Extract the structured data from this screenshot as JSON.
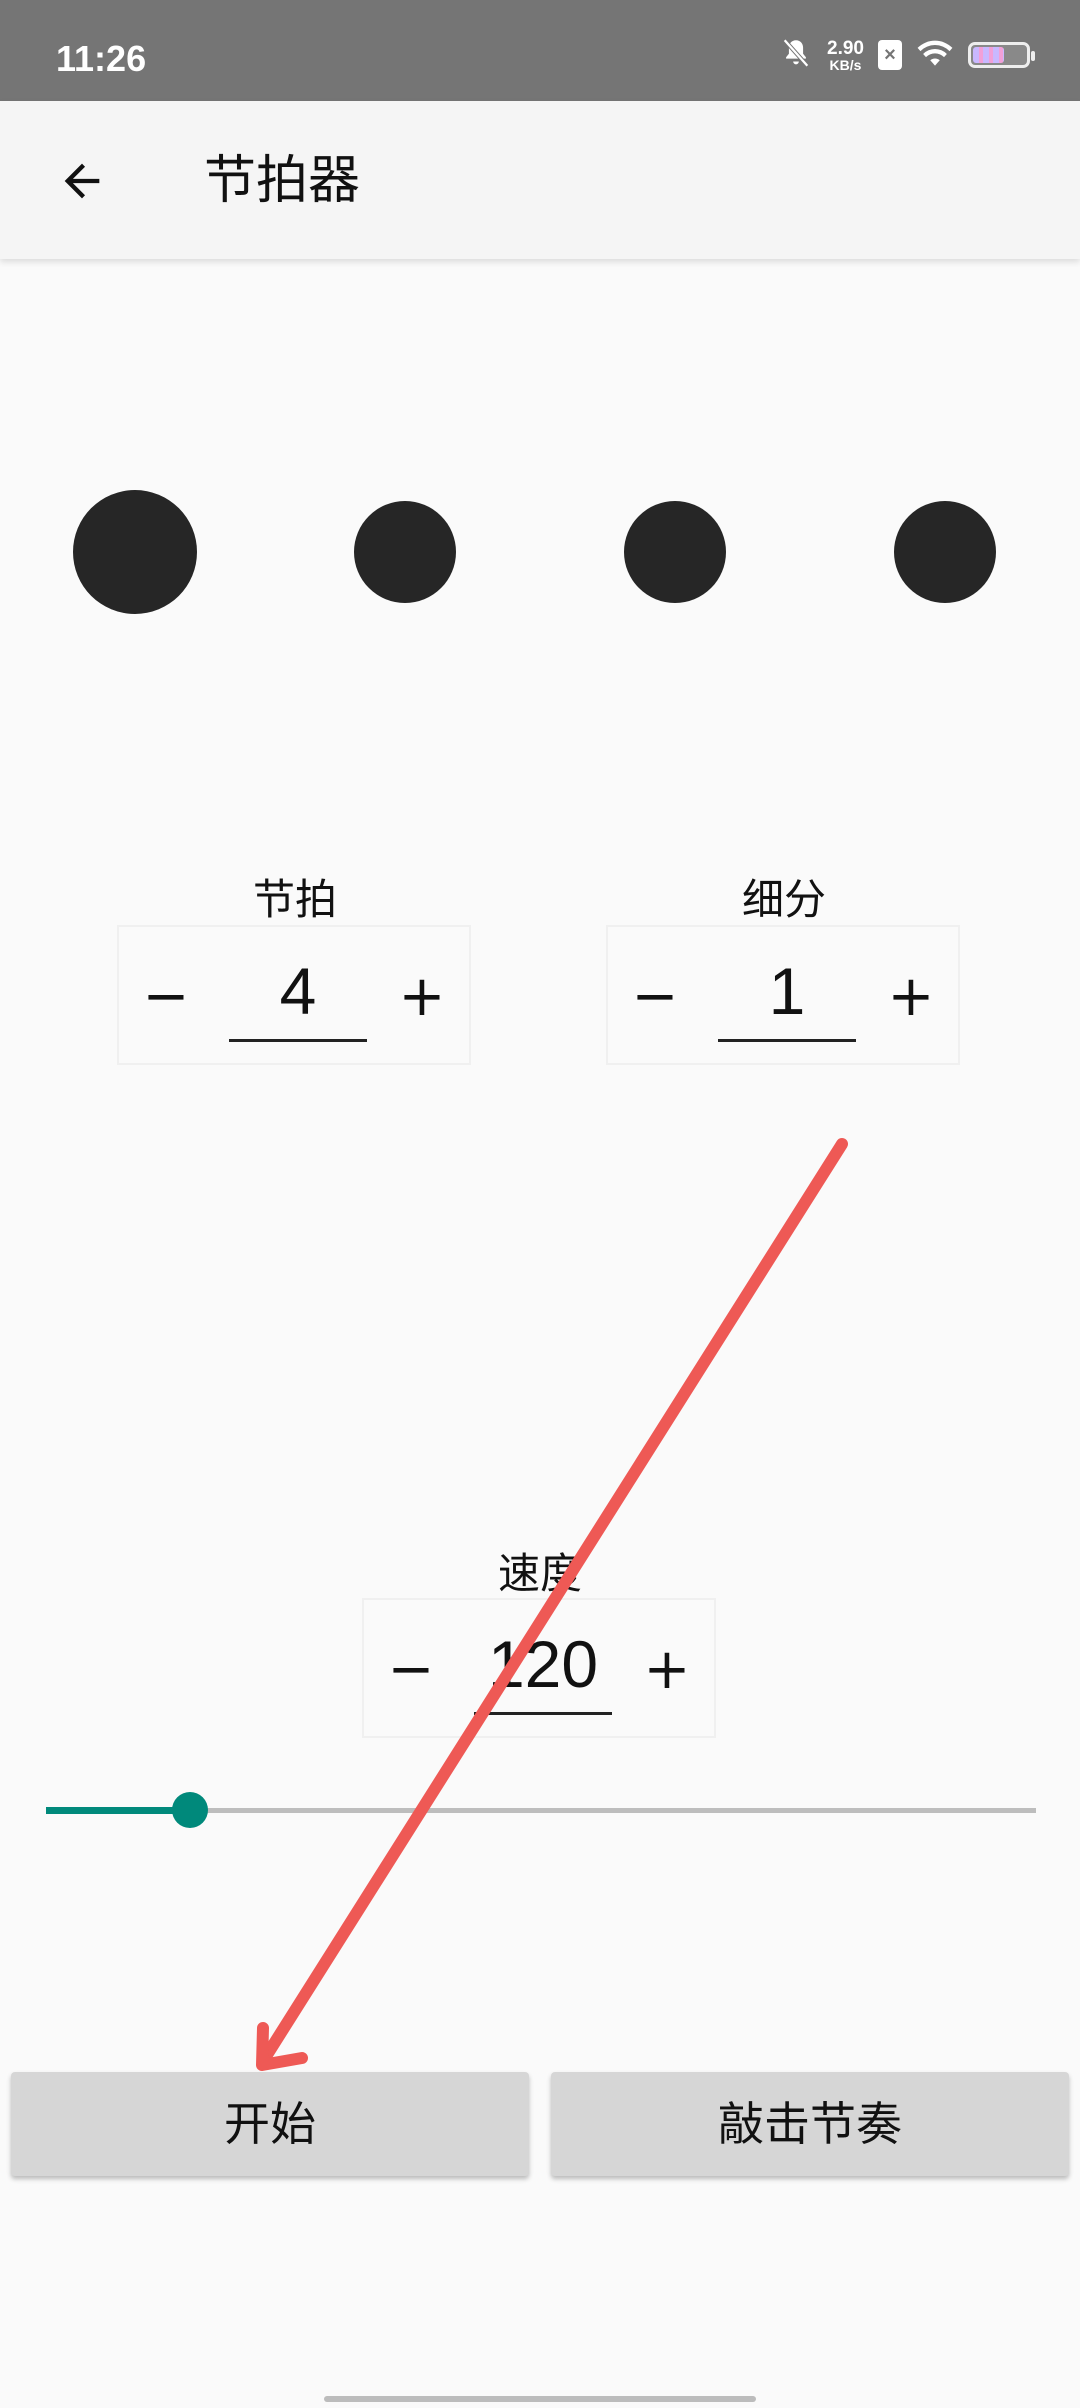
{
  "status_bar": {
    "time": "11:26",
    "net_speed_value": "2.90",
    "net_speed_unit": "KB/s",
    "sim_label": "×",
    "battery_level_fraction": 0.6,
    "icons": [
      "mute-icon",
      "sim-icon",
      "wifi-icon",
      "battery-icon"
    ]
  },
  "app_bar": {
    "title": "节拍器",
    "back_icon": "arrow-left-icon"
  },
  "beats": {
    "count": 4,
    "accent_index": 0
  },
  "beat_control": {
    "label": "节拍",
    "value": "4",
    "minus": "−",
    "plus": "+"
  },
  "subdivision_control": {
    "label": "细分",
    "value": "1",
    "minus": "−",
    "plus": "+"
  },
  "tempo_control": {
    "label": "速度",
    "value": "120",
    "minus": "−",
    "plus": "+"
  },
  "tempo_slider": {
    "level_fraction": 0.145,
    "color": "#00897b"
  },
  "buttons": {
    "start": "开始",
    "tap_tempo": "敲击节奏"
  },
  "annotation": {
    "type": "arrow",
    "color": "#ee5955"
  }
}
